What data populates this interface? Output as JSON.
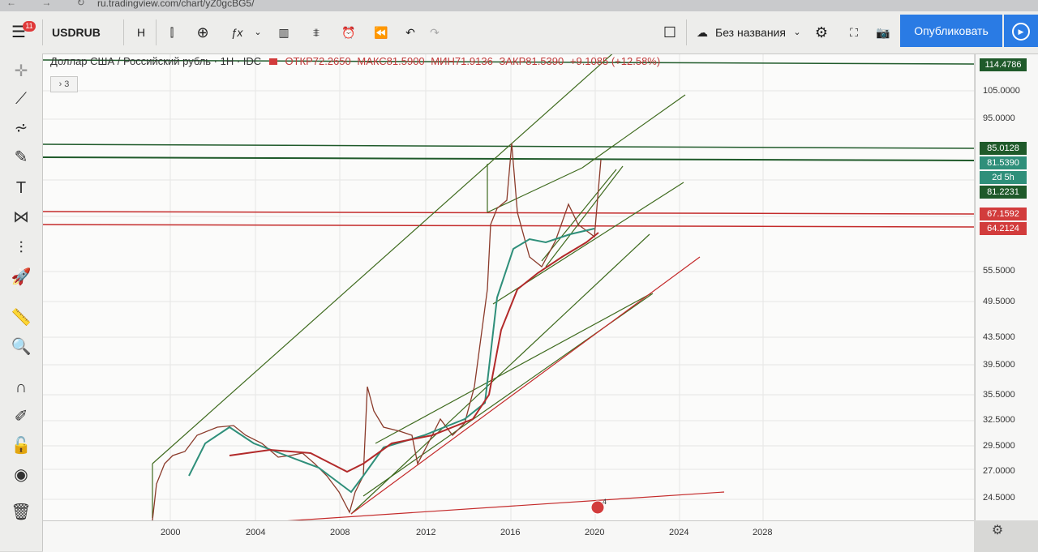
{
  "browser": {
    "url": "ru.tradingview.com/chart/yZ0gcBG5/"
  },
  "toolbar": {
    "symbol": "USDRUB",
    "interval": "H",
    "notif_count": "11",
    "layout_name": "Без названия",
    "publish_label": "Опубликовать"
  },
  "legend": {
    "title": "Доллар США / Российский рубль · 1H · IDC",
    "open": "ОТКР72.2650",
    "high": "МАКС81.5900",
    "low": "МИН71.9136",
    "close": "ЗАКР81.5390",
    "change": "+9.1085 (+12.58%)",
    "collapsed_count": "3"
  },
  "price_axis": {
    "labels": [
      "105.0000",
      "95.0000",
      "55.5000",
      "49.5000",
      "43.5000",
      "39.5000",
      "35.5000",
      "32.5000",
      "29.5000",
      "27.0000",
      "24.5000"
    ],
    "tags": [
      {
        "text": "114.4786",
        "color": "#1f5a2a"
      },
      {
        "text": "85.0128",
        "color": "#1f5a2a"
      },
      {
        "text": "81.5390",
        "color": "#2f8f7a"
      },
      {
        "text": "2d 5h",
        "color": "#2f8f7a"
      },
      {
        "text": "81.2231",
        "color": "#1f5a2a"
      },
      {
        "text": "67.1592",
        "color": "#d23c3c"
      },
      {
        "text": "64.2124",
        "color": "#d23c3c"
      }
    ]
  },
  "time_axis": {
    "labels": [
      "2000",
      "2004",
      "2008",
      "2012",
      "2016",
      "2020",
      "2024",
      "2028"
    ]
  },
  "events": {
    "flag_count": "4"
  },
  "colors": {
    "accent": "#2a7be4",
    "support_red": "#c42b2b",
    "channel_green": "#3f6b1f",
    "ma_teal": "#2f8f7a",
    "ma_red": "#b22a2a"
  }
}
